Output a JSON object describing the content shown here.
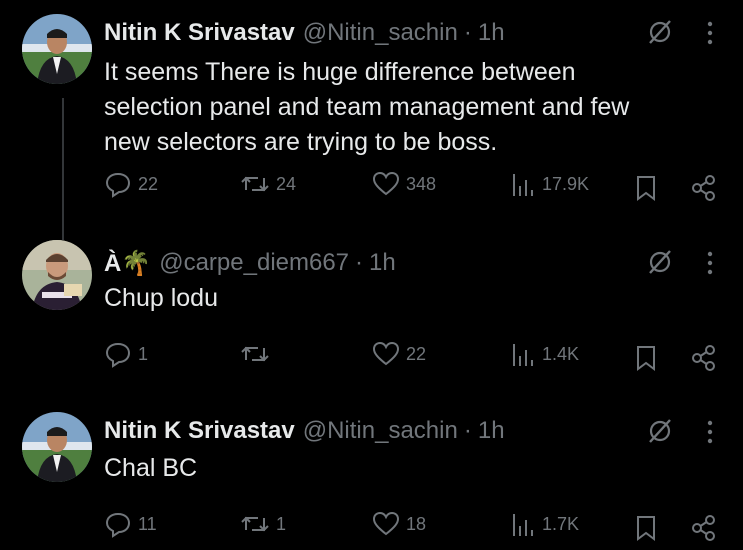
{
  "colors": {
    "background": "#000000",
    "text": "#e7e9ea",
    "secondary": "#71767b",
    "thread_line": "#333639"
  },
  "tweets": [
    {
      "name": "Nitin K Srivastav",
      "handle": "@Nitin_sachin",
      "separator": "·",
      "time": "1h",
      "text_lines": [
        "It seems There is huge difference between",
        "selection panel and team management and few",
        "new selectors are trying to be boss."
      ],
      "replies": "22",
      "reposts": "24",
      "likes": "348",
      "views": "17.9K",
      "icons": [
        "grok-icon",
        "more-icon",
        "reply-icon",
        "repost-icon",
        "like-icon",
        "views-icon",
        "bookmark-icon",
        "share-icon"
      ]
    },
    {
      "name": "À🌴",
      "handle": "@carpe_diem667",
      "separator": "·",
      "time": "1h",
      "text_lines": [
        "Chup lodu"
      ],
      "replies": "1",
      "reposts": "",
      "likes": "22",
      "views": "1.4K"
    },
    {
      "name": "Nitin K Srivastav",
      "handle": "@Nitin_sachin",
      "separator": "·",
      "time": "1h",
      "text_lines": [
        "Chal BC"
      ],
      "replies": "11",
      "reposts": "1",
      "likes": "18",
      "views": "1.7K"
    }
  ]
}
